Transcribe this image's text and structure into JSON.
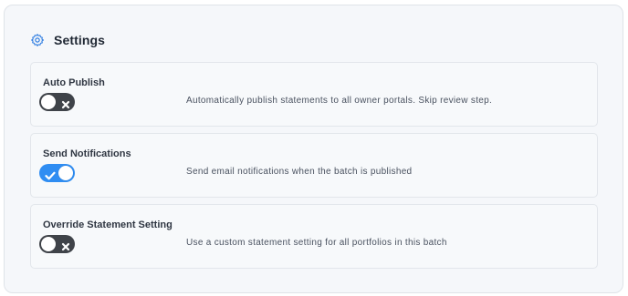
{
  "settings": {
    "title": "Settings",
    "items": [
      {
        "label": "Auto Publish",
        "description": "Automatically publish statements to all owner portals. Skip review step.",
        "enabled": false
      },
      {
        "label": "Send Notifications",
        "description": "Send email notifications when the batch is published",
        "enabled": true
      },
      {
        "label": "Override Statement Setting",
        "description": "Use a custom statement setting for all portfolios in this batch",
        "enabled": false
      }
    ]
  },
  "colors": {
    "toggle_on": "#2f8df2",
    "toggle_off": "#3f4349",
    "gear_icon": "#2f7de1"
  },
  "icons": {
    "header": "gear-icon",
    "toggle_on": "check-icon",
    "toggle_off": "close-icon"
  }
}
